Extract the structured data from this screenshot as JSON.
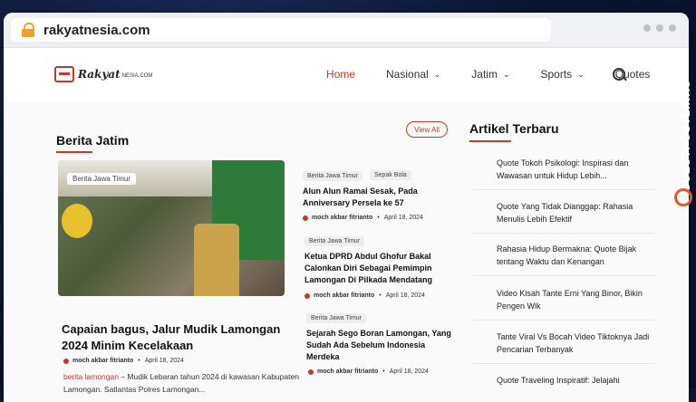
{
  "browser": {
    "url": "rakyatnesia.com"
  },
  "site": {
    "logo_text": "Rakyat",
    "logo_sub": "NESIA.COM"
  },
  "nav": {
    "items": [
      {
        "label": "Home",
        "active": true,
        "has_dropdown": false
      },
      {
        "label": "Nasional",
        "has_dropdown": true
      },
      {
        "label": "Jatim",
        "has_dropdown": true
      },
      {
        "label": "Sports",
        "has_dropdown": true
      },
      {
        "label": "Quotes",
        "has_dropdown": false
      }
    ]
  },
  "berita_jatim": {
    "title": "Berita Jatim",
    "view_all": "View All",
    "featured": {
      "category": "Berita Jawa Timur",
      "title": "Capaian bagus, Jalur Mudik Lamongan 2024 Minim Kecelakaan",
      "author": "moch akbar fitrianto",
      "date": "April 18, 2024",
      "excerpt_category": "berita lamongan",
      "excerpt": " – Mudik Lebaran tahun 2024 di kawasan Kabupaten Lamongan. Satlantas Polres Lamongan..."
    },
    "articles": [
      {
        "categories": [
          "Berita Jawa Timur",
          "Sepak Bola"
        ],
        "title": "Alun Alun Ramai Sesak, Pada Anniversary Persela ke 57",
        "author": "moch akbar fitrianto",
        "date": "April 18, 2024"
      },
      {
        "categories": [
          "Berita Jawa Timur"
        ],
        "title": "Ketua DPRD Abdul Ghofur Bakal Calonkan Diri Sebagai Pemimpin Lamongan Di Pilkada Mendatang",
        "author": "moch akbar fitrianto",
        "date": "April 18, 2024"
      },
      {
        "categories": [
          "Berita Jawa Timur"
        ],
        "title": "Sejarah Sego Boran Lamongan, Yang Sudah Ada Sebelum Indonesia Merdeka",
        "author": "moch akbar fitrianto",
        "date": "April 18, 2024"
      }
    ]
  },
  "sidebar": {
    "title": "Artikel Terbaru",
    "items": [
      "Quote Tokoh Psikologi: Inspirasi dan Wawasan untuk Hidup Lebih...",
      "Quote Yang Tidak Dianggap: Rahasia Menulis Lebih Efektif",
      "Rahasia Hidup Bermakna: Quote Bijak tentang Waktu dan Kenangan",
      "Video Kisah Tante Erni Yang Binor, Bikin Pengen Wik",
      "Tante Viral Vs Bocah Video Tiktoknya Jadi Pencarian Terbanyak",
      "Quote Traveling Inspiratif: Jelajahi"
    ]
  },
  "watermark": {
    "text": "GUESTPOSTLINKS"
  },
  "colors": {
    "accent": "#c0392b",
    "brand_orange": "#e4572e"
  }
}
